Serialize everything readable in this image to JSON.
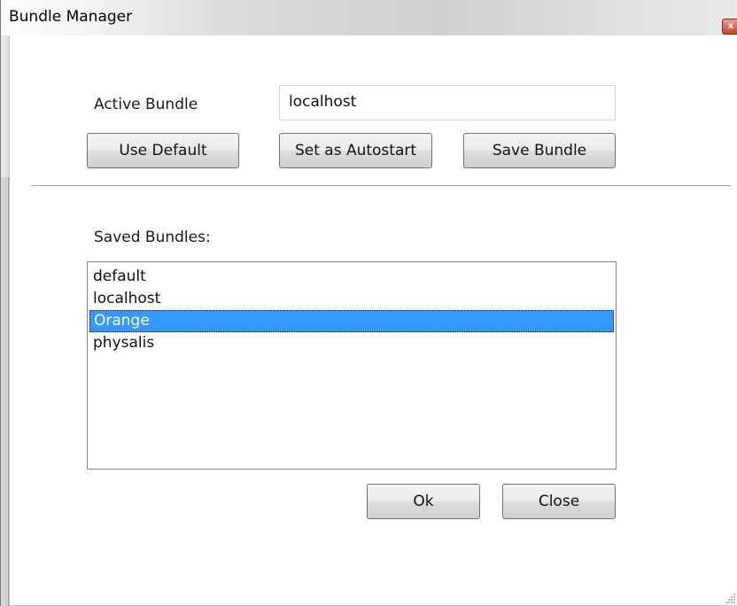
{
  "window": {
    "title": "Bundle Manager",
    "close_symbol": "x"
  },
  "active_bundle": {
    "label": "Active Bundle",
    "value": "localhost"
  },
  "buttons": {
    "use_default": "Use Default",
    "set_autostart": "Set as Autostart",
    "save_bundle": "Save Bundle",
    "ok": "Ok",
    "close": "Close"
  },
  "saved_bundles": {
    "label": "Saved Bundles:",
    "items": [
      "default",
      "localhost",
      "Orange",
      "physalis"
    ],
    "selected": "Orange"
  },
  "colors": {
    "selection": "#3399ff"
  }
}
